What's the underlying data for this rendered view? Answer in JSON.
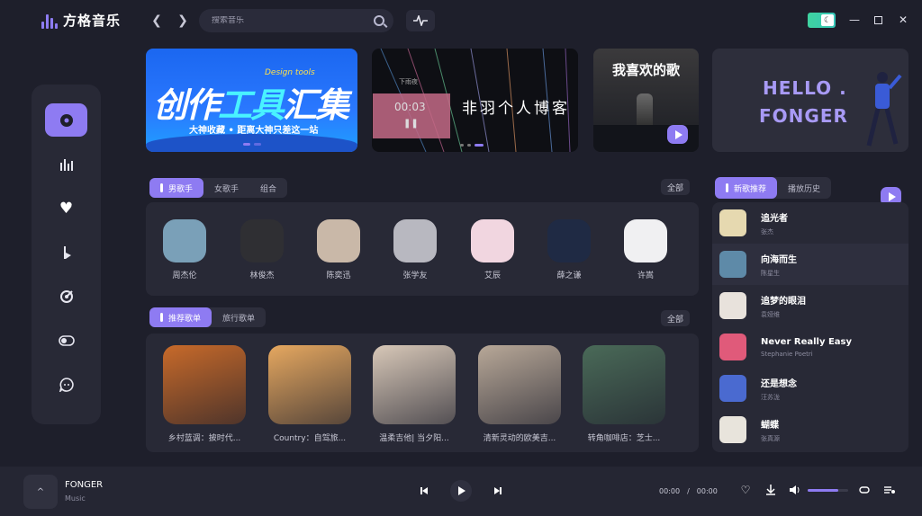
{
  "app": {
    "name": "方格音乐"
  },
  "search": {
    "placeholder": "搜索音乐"
  },
  "banners": {
    "tools": {
      "title_a": "创作",
      "title_b": "工具",
      "title_c": "汇集",
      "english": "Design tools",
      "subtitle": "大神收藏 • 距离大神只差这一站"
    },
    "blog": {
      "text": "非羽个人博客",
      "time": "00:03",
      "mini_title": "下雨夜"
    },
    "fav": {
      "title": "我喜欢的歌"
    },
    "hello": {
      "line1": "HELLO .",
      "line2": "FONGER"
    }
  },
  "artist_tabs": [
    "男歌手",
    "女歌手",
    "组合"
  ],
  "artist_all": "全部",
  "artists": [
    {
      "name": "周杰伦",
      "color": "#7aa0b8"
    },
    {
      "name": "林俊杰",
      "color": "#2f2f33"
    },
    {
      "name": "陈奕迅",
      "color": "#c9b8a8"
    },
    {
      "name": "张学友",
      "color": "#b8b8c0"
    },
    {
      "name": "艾辰",
      "color": "#f1d6e0"
    },
    {
      "name": "薛之谦",
      "color": "#1f2a44"
    },
    {
      "name": "许嵩",
      "color": "#f0f0f2"
    }
  ],
  "playlist_tabs": [
    "推荐歌单",
    "旅行歌单"
  ],
  "playlist_all": "全部",
  "playlists": [
    {
      "name": "乡村蓝调：披时代...",
      "color": "#c86a2a"
    },
    {
      "name": "Country：自驾旅...",
      "color": "#e6a860"
    },
    {
      "name": "温柔吉他| 当夕阳...",
      "color": "#d8c8b8"
    },
    {
      "name": "清新灵动的欧美吉...",
      "color": "#b8a898"
    },
    {
      "name": "转角咖啡店：芝士...",
      "color": "#4a6a58"
    }
  ],
  "right_tabs": [
    "新歌推荐",
    "播放历史"
  ],
  "songs": [
    {
      "title": "追光者",
      "artist": "张杰",
      "color": "#e6d9b0"
    },
    {
      "title": "向海而生",
      "artist": "陈星生",
      "color": "#5e8aa8"
    },
    {
      "title": "追梦的眼泪",
      "artist": "袁娅维",
      "color": "#e8e2dc"
    },
    {
      "title": "Never Really Easy",
      "artist": "Stephanie Poetri",
      "color": "#e05a7a"
    },
    {
      "title": "还是想念",
      "artist": "汪苏泷",
      "color": "#4a6ad0"
    },
    {
      "title": "蝴蝶",
      "artist": "张真源",
      "color": "#e8e4dc"
    }
  ],
  "player": {
    "cover_icon": "^",
    "title": "FONGER",
    "subtitle": "Music",
    "current": "00:00",
    "separator": "/",
    "total": "00:00",
    "volume": 0.75
  },
  "colors": {
    "accent": "#8e7bf2",
    "bg": "#1e1f2b",
    "panel": "#282936",
    "toggle": "#3fd3a0"
  }
}
